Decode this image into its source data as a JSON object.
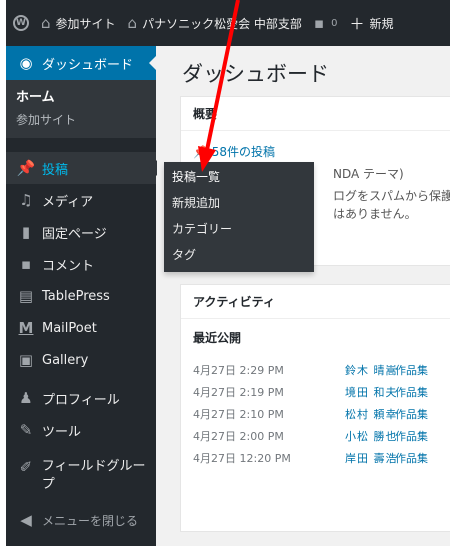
{
  "admin_bar": {
    "site_name": "参加サイト",
    "site2_name": "パナソニック松愛会 中部支部",
    "comment_count": "0",
    "new_label": "新規"
  },
  "sidebar": {
    "dashboard": "ダッシュボード",
    "submenu_home": "ホーム",
    "submenu_sites": "参加サイト",
    "items": [
      {
        "label": "投稿",
        "icon": "pin-icon"
      },
      {
        "label": "メディア",
        "icon": "media-icon"
      },
      {
        "label": "固定ページ",
        "icon": "page-icon"
      },
      {
        "label": "コメント",
        "icon": "comment-icon"
      },
      {
        "label": "TablePress",
        "icon": "table-icon"
      },
      {
        "label": "MailPoet",
        "icon": "mailpoet-icon"
      },
      {
        "label": "Gallery",
        "icon": "gallery-icon"
      },
      {
        "label": "プロフィール",
        "icon": "user-icon"
      },
      {
        "label": "ツール",
        "icon": "wrench-icon"
      },
      {
        "label": "フィールドグループ",
        "icon": "field-icon"
      }
    ],
    "collapse": "メニューを閉じる"
  },
  "flyout": [
    "投稿一覧",
    "新規追加",
    "カテゴリー",
    "タグ"
  ],
  "main": {
    "title": "ダッシュボード",
    "glance_title": "概要",
    "posts_count": "58件の投稿",
    "theme_fragment": "NDA テーマ)",
    "spam_text_1": "ログをスパムから保護して",
    "spam_text_2": "はありません。",
    "activity_title": "アクティビティ",
    "recent_label": "最近公開",
    "activity": [
      {
        "date": "4月27日 2:29 PM",
        "author": "鈴木 晴嵩",
        "title": "作品集"
      },
      {
        "date": "4月27日 2:19 PM",
        "author": "境田 和夫",
        "title": "作品集"
      },
      {
        "date": "4月27日 2:10 PM",
        "author": "松村 頼幸",
        "title": "作品集"
      },
      {
        "date": "4月27日 2:00 PM",
        "author": "小松 勝也",
        "title": "作品集"
      },
      {
        "date": "4月27日 12:20 PM",
        "author": "岸田 壽浩",
        "title": "作品集"
      }
    ]
  },
  "colors": {
    "accent": "#0073aa",
    "admin_bg": "#23282d",
    "arrow": "#ff0000"
  }
}
